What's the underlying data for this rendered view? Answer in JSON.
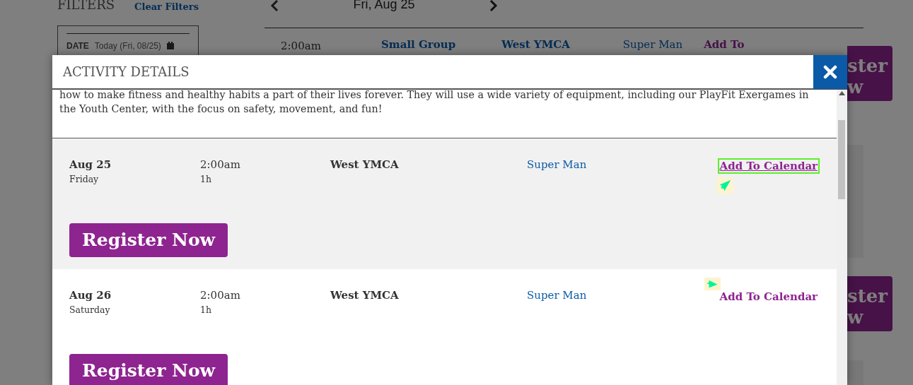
{
  "background": {
    "filters_title": "FILTERS",
    "clear_filters": "Clear Filters",
    "date_label": "DATE",
    "date_value": "Today (Fri, 08/25)",
    "current_date": "Fri, Aug 25",
    "rows": [
      {
        "time": "2:00am",
        "type": "Small Group",
        "location": "West YMCA",
        "instructor": "Super Man",
        "calendar_link": "Add To",
        "register_lines": [
          "ster",
          "w"
        ]
      },
      {
        "register_lines": [
          "ster",
          "w"
        ]
      }
    ]
  },
  "modal": {
    "title": "ACTIVITY DETAILS",
    "description": "how to make fitness and healthy habits a part of their lives forever. They will use a wide variety of equipment, including our PlayFit Exergames in the Youth Center, with the focus on safety, movement, and fun!",
    "sessions": [
      {
        "date": "Aug 25",
        "weekday": "Friday",
        "time": "2:00am",
        "duration": "1h",
        "location": "West YMCA",
        "instructor": "Super Man",
        "calendar_link": "Add To Calendar",
        "focused": true,
        "highlighted": true,
        "register": "Register Now"
      },
      {
        "date": "Aug 26",
        "weekday": "Saturday",
        "time": "2:00am",
        "duration": "1h",
        "location": "West YMCA",
        "instructor": "Super Man",
        "calendar_link": "Add To Calendar",
        "focused": false,
        "highlighted": false,
        "register": "Register Now"
      }
    ]
  }
}
